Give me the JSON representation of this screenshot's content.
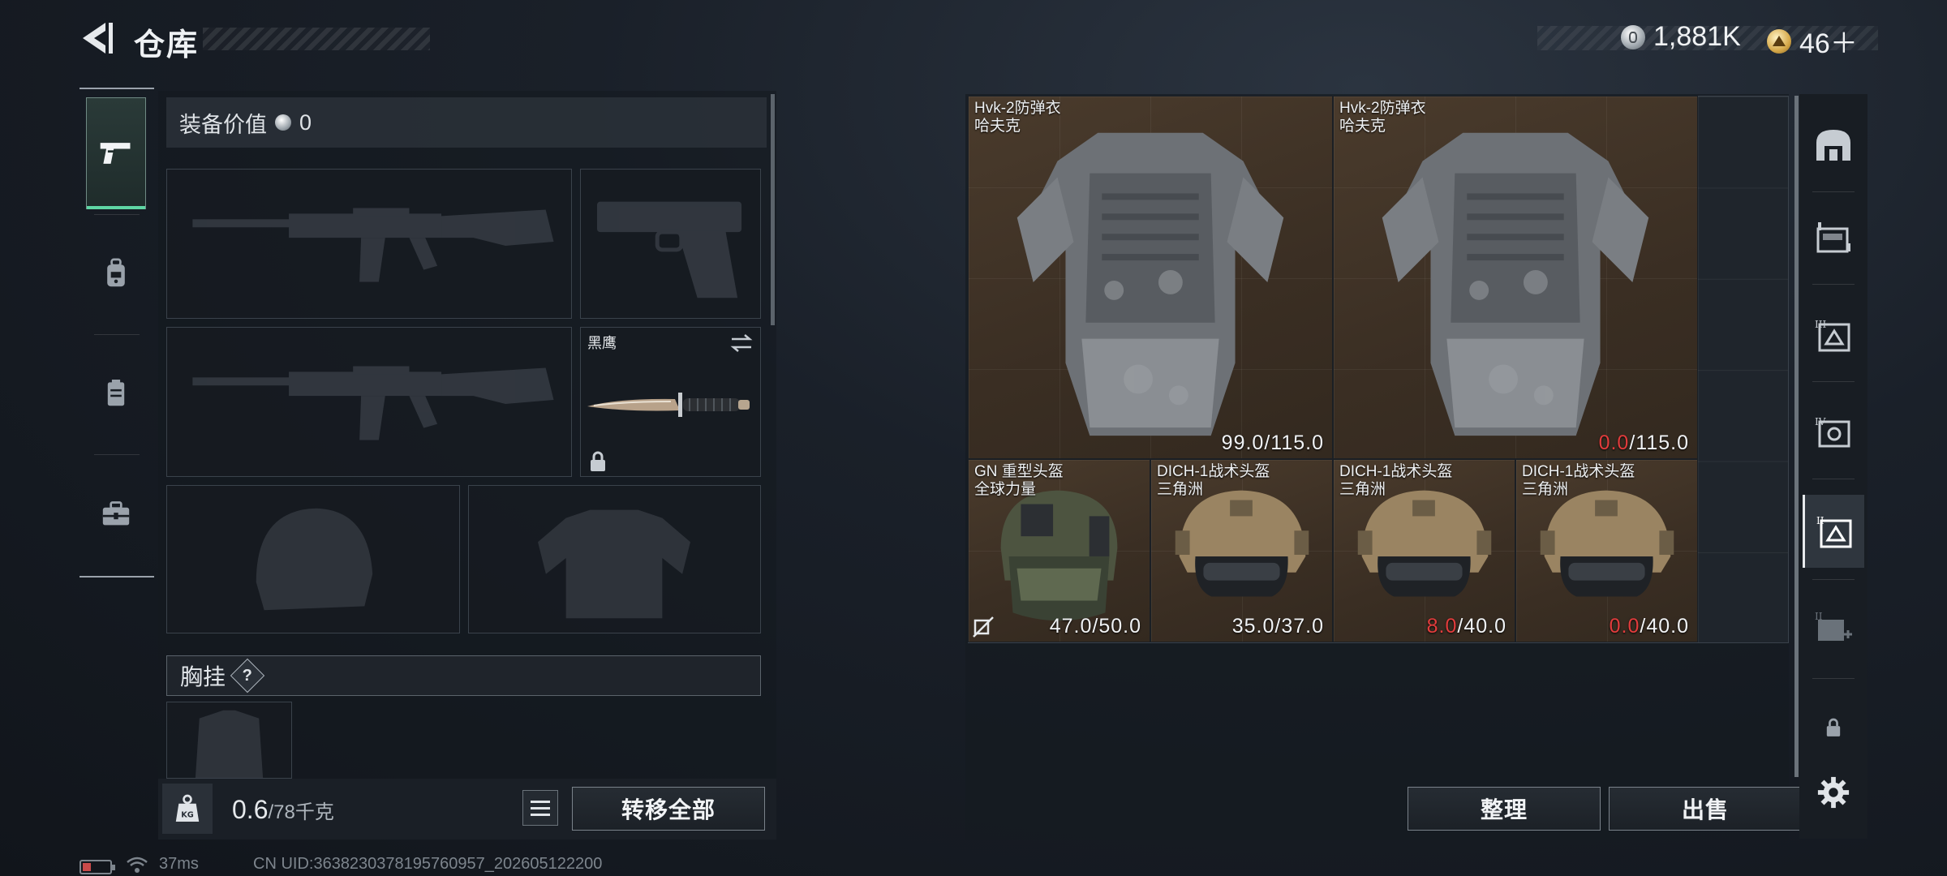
{
  "header": {
    "title": "仓库",
    "currency": [
      {
        "icon": "silver-coin-icon",
        "value": "1,881K"
      },
      {
        "icon": "gold-coin-icon",
        "value": "46＋"
      }
    ]
  },
  "left_rail": {
    "items": [
      {
        "name": "weapons",
        "icon": "pistol-icon",
        "active": true
      },
      {
        "name": "armor",
        "icon": "backpack-icon",
        "active": false
      },
      {
        "name": "chest-rig",
        "icon": "vest-icon",
        "active": false
      },
      {
        "name": "tools",
        "icon": "toolbox-icon",
        "active": false
      }
    ]
  },
  "loadout": {
    "value_label": "装备价值",
    "value_amount": "0",
    "melee_name": "黑鹰",
    "chest_rig_label": "胸挂",
    "help_symbol": "?"
  },
  "bottom_left": {
    "weight_value": "0.6",
    "weight_capacity": "/78千克",
    "weight_icon_label": "KG",
    "transfer_all_label": "转移全部"
  },
  "status_bar": {
    "ping": "37ms",
    "uid": "CN UID:3638230378195760957_202605122200"
  },
  "storage": {
    "items": [
      {
        "name": "Hvk-2防弹衣",
        "brand": "哈夫克",
        "dur_current": "99.0",
        "dur_max": "/115.0",
        "broken": false,
        "type": "armor"
      },
      {
        "name": "Hvk-2防弹衣",
        "brand": "哈夫克",
        "dur_current": "0.0",
        "dur_max": "/115.0",
        "broken": true,
        "type": "armor"
      },
      {
        "name": "GN 重型头盔",
        "brand": "全球力量",
        "dur_current": "47.0",
        "dur_max": "/50.0",
        "broken": false,
        "type": "helmet-gn"
      },
      {
        "name": "DICH-1战术头盔",
        "brand": "三角洲",
        "dur_current": "35.0",
        "dur_max": "/37.0",
        "broken": false,
        "type": "helmet"
      },
      {
        "name": "DICH-1战术头盔",
        "brand": "三角洲",
        "dur_current": "8.0",
        "dur_max": "/40.0",
        "broken": true,
        "type": "helmet"
      },
      {
        "name": "DICH-1战术头盔",
        "brand": "三角洲",
        "dur_current": "0.0",
        "dur_max": "/40.0",
        "broken": true,
        "type": "helmet"
      }
    ],
    "sort_label": "整理",
    "sell_label": "出售"
  },
  "side_tabs": [
    {
      "icon": "safe-box-icon",
      "active": false
    },
    {
      "icon": "storage-1-icon",
      "active": false
    },
    {
      "icon": "storage-3-icon",
      "active": false
    },
    {
      "icon": "storage-4-icon",
      "active": false
    },
    {
      "icon": "storage-2-icon",
      "active": true
    },
    {
      "icon": "storage-add-icon",
      "active": false
    },
    {
      "icon": "lock-icon",
      "active": false
    },
    {
      "icon": "settings-gear-icon",
      "active": false
    }
  ],
  "colors": {
    "accent_green": "#5fd6a4",
    "durability_red": "#e23c3c",
    "item_bg": "#3a2e23"
  }
}
